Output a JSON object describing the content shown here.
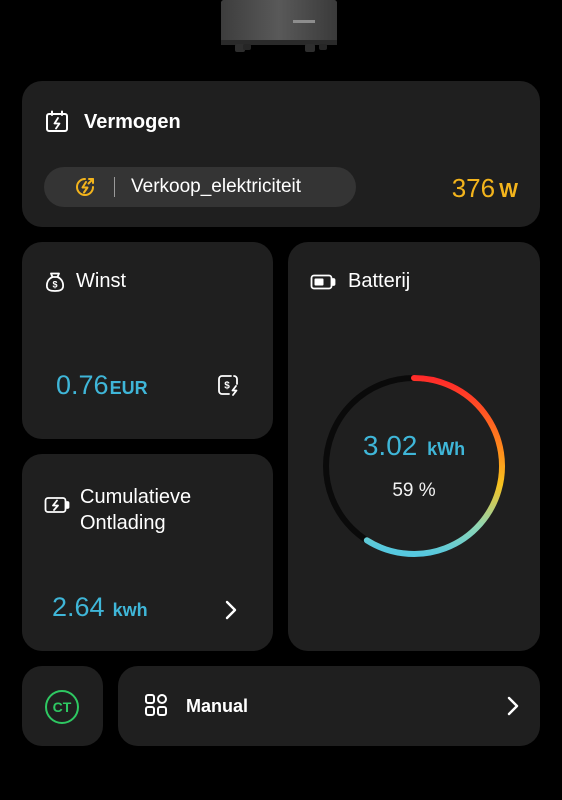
{
  "power": {
    "title": "Vermogen",
    "mode_label": "Verkoop_elektriciteit",
    "value": "376",
    "unit": "W"
  },
  "profit": {
    "title": "Winst",
    "value": "0.76",
    "unit": "EUR"
  },
  "battery": {
    "title": "Batterij",
    "energy_value": "3.02",
    "energy_unit": "kWh",
    "percent_text": "59 %",
    "percent": 59
  },
  "discharge": {
    "title_line1": "Cumulatieve",
    "title_line2": "Ontlading",
    "value": "2.64",
    "unit": "kwh"
  },
  "ct": {
    "label": "CT"
  },
  "manual": {
    "label": "Manual"
  },
  "colors": {
    "background": "#000000",
    "card": "#1f1f1f",
    "accent_blue": "#3fb6d8",
    "power_yellow": "#f3b41c",
    "ct_green": "#2ec862",
    "ring_red": "#ff2a2a",
    "ring_orange": "#ff8a1c",
    "ring_yellow": "#f7c21e",
    "ring_blue": "#56c8df"
  }
}
